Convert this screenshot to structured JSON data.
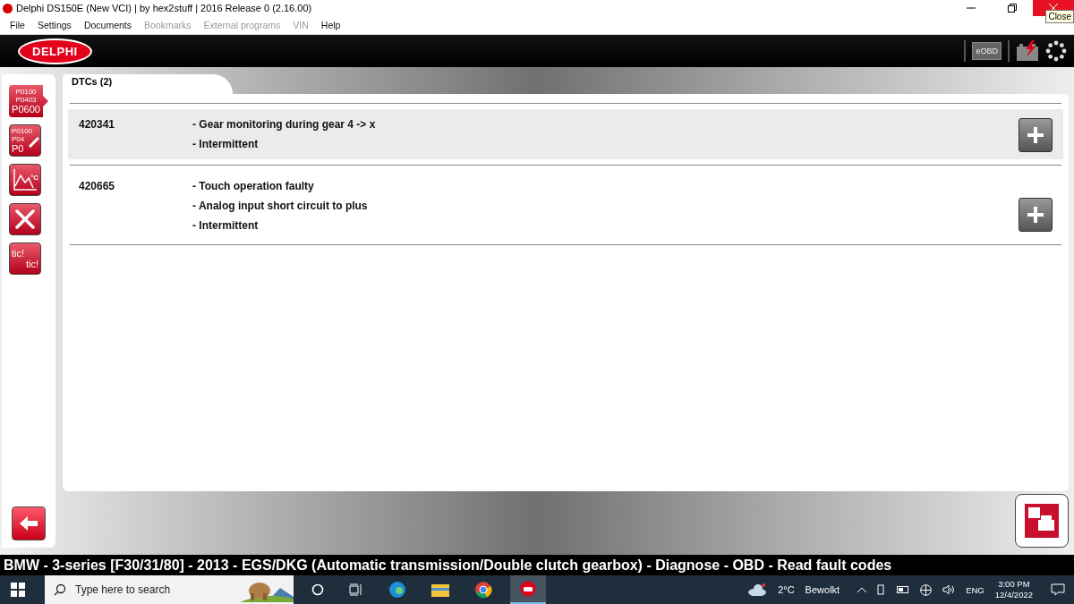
{
  "window": {
    "title": "Delphi DS150E (New VCI) | by hex2stuff | 2016 Release 0 (2.16.00)",
    "close_tooltip": "Close"
  },
  "menu": [
    {
      "label": "File",
      "disabled": false
    },
    {
      "label": "Settings",
      "disabled": false
    },
    {
      "label": "Documents",
      "disabled": false
    },
    {
      "label": "Bookmarks",
      "disabled": true
    },
    {
      "label": "External programs",
      "disabled": true
    },
    {
      "label": "VIN",
      "disabled": true
    },
    {
      "label": "Help",
      "disabled": false
    }
  ],
  "header": {
    "logo": "DELPHI",
    "eobd": "eOBD"
  },
  "sidebar": [
    {
      "kind": "codes",
      "lines": [
        "P0100",
        "P0403",
        "P0600"
      ],
      "selected": true
    },
    {
      "kind": "codes-edit",
      "lines": [
        "P0100",
        "P04",
        "P0"
      ],
      "selected": false
    },
    {
      "kind": "graph",
      "lines": [
        "°C"
      ],
      "selected": false
    },
    {
      "kind": "tools",
      "selected": false
    },
    {
      "kind": "tic",
      "lines": [
        "tic!",
        "tic!"
      ],
      "selected": false
    }
  ],
  "tab": {
    "label": "DTCs (2)"
  },
  "faults": [
    {
      "code": "420341",
      "lines": [
        "- Gear monitoring during gear 4 -> x",
        "- Intermittent"
      ],
      "selected": true
    },
    {
      "code": "420665",
      "lines": [
        "- Touch operation faulty",
        "- Analog input short circuit to plus",
        "- Intermittent"
      ],
      "selected": false
    }
  ],
  "status_line": "BMW - 3-series [F30/31/80] - 2013 - EGS/DKG (Automatic transmission/Double clutch gearbox) - Diagnose - OBD - Read fault codes",
  "taskbar": {
    "search_placeholder": "Type here to search",
    "temperature": "2°C",
    "weather": "Bewolkt",
    "language": "ENG",
    "time": "3:00 PM",
    "date": "12/4/2022"
  }
}
